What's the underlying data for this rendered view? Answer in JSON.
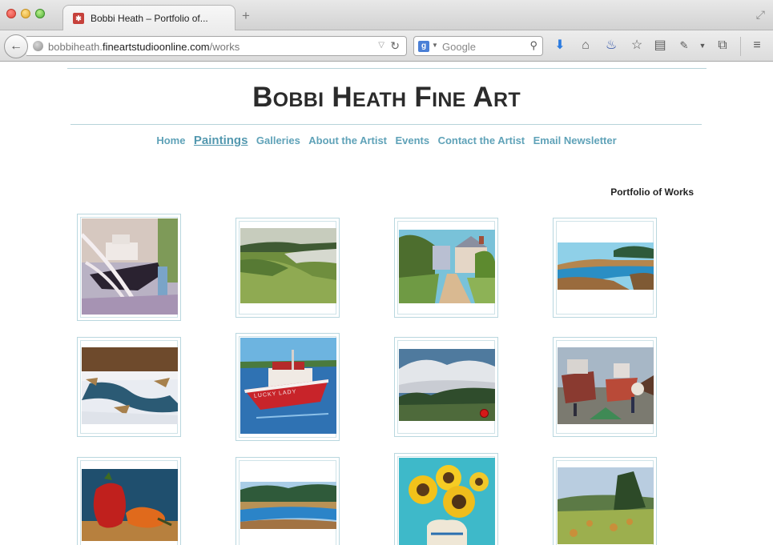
{
  "browser": {
    "tab_title": "Bobbi Heath – Portfolio of...",
    "new_tab_label": "+",
    "url_prefix": "bobbiheath.",
    "url_host": "fineartstudioonline.com",
    "url_path": "/works",
    "search_placeholder": "Google",
    "toolbar_icons": [
      "download-icon",
      "home-icon",
      "fire-icon",
      "bookmark-star-icon",
      "reading-list-icon",
      "evernote-icon",
      "screenshot-icon",
      "menu-icon"
    ]
  },
  "site": {
    "title": "Bobbi Heath Fine Art",
    "nav": [
      {
        "label": "Home",
        "active": false
      },
      {
        "label": "Paintings",
        "active": true
      },
      {
        "label": "Galleries",
        "active": false
      },
      {
        "label": "About the Artist",
        "active": false
      },
      {
        "label": "Events",
        "active": false
      },
      {
        "label": "Contact the Artist",
        "active": false
      },
      {
        "label": "Email Newsletter",
        "active": false
      }
    ],
    "portfolio_heading": "Portfolio of Works"
  },
  "colors": {
    "accent": "#5fa2b8",
    "rule": "#b7d3d9",
    "sold_badge": "#d51818"
  },
  "works": [
    {
      "subject": "boat on stands in boatyard",
      "sold": false
    },
    {
      "subject": "green river landscape",
      "sold": false
    },
    {
      "subject": "village lane with houses",
      "sold": false
    },
    {
      "subject": "blue tidal inlet",
      "sold": false
    },
    {
      "subject": "winter snow creek",
      "sold": false
    },
    {
      "subject": "red lobster boat Lucky Lady",
      "sold": false
    },
    {
      "subject": "clouds over treeline",
      "sold": true
    },
    {
      "subject": "boats hauled out with figures",
      "sold": false
    },
    {
      "subject": "red and orange peppers",
      "sold": false
    },
    {
      "subject": "marsh river with pines",
      "sold": false
    },
    {
      "subject": "sunflowers in pitcher",
      "sold": false
    },
    {
      "subject": "hay field with trees",
      "sold": false
    }
  ],
  "boat_name": "LUCKY LADY"
}
